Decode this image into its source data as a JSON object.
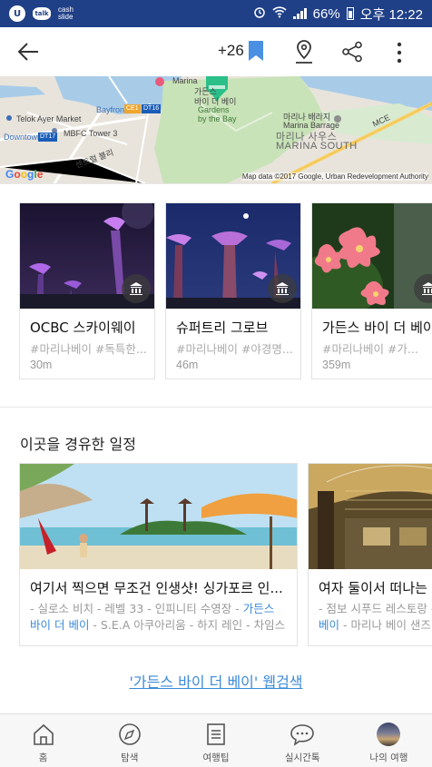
{
  "status_bar": {
    "app_icon_1": "U",
    "app_icon_2": "talk",
    "cash_top": "cash",
    "cash_bottom": "slide",
    "battery": "66%",
    "time": "오후 12:22"
  },
  "toolbar": {
    "bookmark_count": "+26",
    "icons": [
      "back-arrow-icon",
      "bookmark-icon",
      "map-pin-icon",
      "share-icon",
      "more-icon"
    ],
    "bookmark_color": "#4a90e2"
  },
  "map": {
    "labels": {
      "telok_ayer": "Telok Ayer Market",
      "bayfront": "Bayfront",
      "downtown": "Downtown",
      "mbfc": "MBFC Tower 3",
      "ko_road": "센트럴 블리",
      "gardens_ko": "가든스",
      "gardens_ko2": "바이 더 베이",
      "gardens_en1": "Gardens",
      "gardens_en2": "by the Bay",
      "barrage_ko": "마리나 배라지",
      "barrage_en": "Marina Barrage",
      "south_ko": "마리나 사우스",
      "south_en": "MARINA SOUTH",
      "mce": "MCE",
      "marina": "Marina"
    },
    "shields": {
      "ce1": "CE1",
      "dt16": "DT16",
      "dt17": "DT17"
    },
    "google": [
      "G",
      "o",
      "o",
      "g",
      "l",
      "e"
    ],
    "attribution": "Map data ©2017 Google, Urban Redevelopment Authority"
  },
  "nearby": [
    {
      "title": "OCBC 스카이웨이",
      "tags": "#마리나베이 #독특한...",
      "distance": "30m"
    },
    {
      "title": "슈퍼트리 그로브",
      "tags": "#마리나베이 #야경명...",
      "distance": "46m"
    },
    {
      "title": "가든스 바이 더 베이",
      "tags": "#마리나베이 #가...",
      "distance": "359m"
    }
  ],
  "itinerary_section": {
    "title": "이곳을 경유한 일정",
    "items": [
      {
        "title": "여기서 찍으면 무조건 인생샷! 싱가포르 인...",
        "line1_pre": "- 실로소 비치 - 레벨 33 - 인피니티 수영장 - ",
        "line1_hl": "가든스",
        "line2_hl": "바이 더 베이",
        "line2_post": " - S.E.A 아쿠아리움 - 하지 레인 - 차임스"
      },
      {
        "title": "여자 둘이서 떠나는 싱가포르",
        "line1_pre": "- 점보 시푸드 레스토랑 - ",
        "line1_hl": "",
        "line2_hl": "베이",
        "line2_post": " - 마리나 베이 샌즈"
      }
    ]
  },
  "web_search_link": "'가든스 바이 더 베이' 웹검색",
  "bottom_nav": [
    {
      "label": "홈",
      "icon": "home-icon"
    },
    {
      "label": "탐색",
      "icon": "compass-icon"
    },
    {
      "label": "여행팁",
      "icon": "document-icon"
    },
    {
      "label": "실시간톡",
      "icon": "chat-bubble-icon"
    },
    {
      "label": "나의 여행",
      "icon": "avatar"
    }
  ]
}
